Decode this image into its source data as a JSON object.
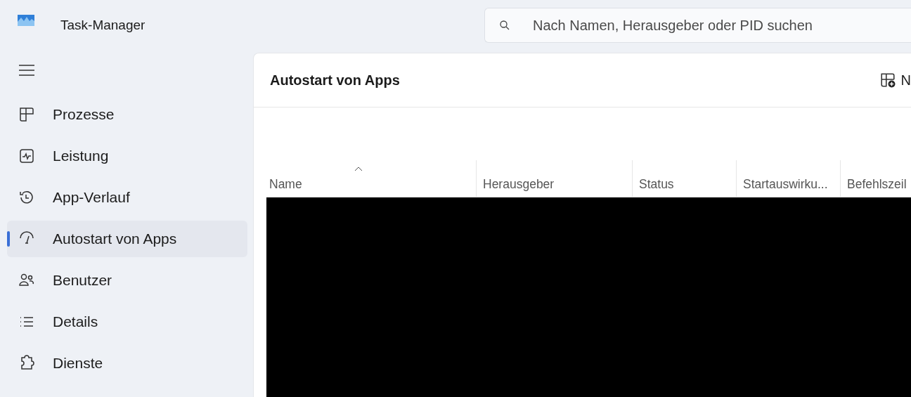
{
  "window": {
    "title": "Task-Manager"
  },
  "search": {
    "placeholder": "Nach Namen, Herausgeber oder PID suchen"
  },
  "sidebar": {
    "items": [
      {
        "label": "Prozesse",
        "selected": false
      },
      {
        "label": "Leistung",
        "selected": false
      },
      {
        "label": "App-Verlauf",
        "selected": false
      },
      {
        "label": "Autostart von Apps",
        "selected": true
      },
      {
        "label": "Benutzer",
        "selected": false
      },
      {
        "label": "Details",
        "selected": false
      },
      {
        "label": "Dienste",
        "selected": false
      }
    ]
  },
  "page": {
    "title": "Autostart von Apps",
    "toolbar_button": "N"
  },
  "table": {
    "columns": [
      {
        "label": "Name",
        "sorted": true
      },
      {
        "label": "Herausgeber",
        "sorted": false
      },
      {
        "label": "Status",
        "sorted": false
      },
      {
        "label": "Startauswirku...",
        "sorted": false
      },
      {
        "label": "Befehlszeil",
        "sorted": false
      }
    ],
    "rows_redacted": true
  }
}
